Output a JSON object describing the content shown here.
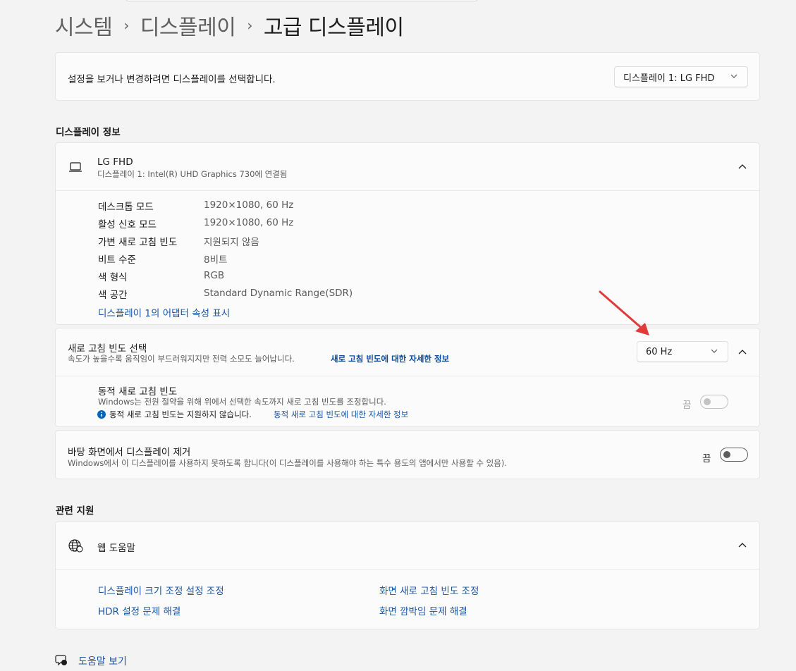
{
  "breadcrumb": {
    "items": [
      "시스템",
      "디스플레이",
      "고급 디스플레이"
    ],
    "separator": "›"
  },
  "select_display": {
    "prompt": "설정을 보거나 변경하려면 디스플레이를 선택합니다.",
    "selected": "디스플레이 1: LG FHD"
  },
  "display_info": {
    "section_title": "디스플레이 정보",
    "monitor_name": "LG FHD",
    "monitor_sub": "디스플레이 1: Intel(R) UHD Graphics 730에 연결됨",
    "rows": [
      {
        "label": "데스크톱 모드",
        "value": "1920×1080, 60 Hz"
      },
      {
        "label": "활성 신호 모드",
        "value": "1920×1080, 60 Hz"
      },
      {
        "label": "가변 새로 고침 빈도",
        "value": "지원되지 않음"
      },
      {
        "label": "비트 수준",
        "value": "8비트"
      },
      {
        "label": "색 형식",
        "value": "RGB"
      },
      {
        "label": "색 공간",
        "value": "Standard Dynamic Range(SDR)"
      }
    ],
    "adapter_link": "디스플레이 1의 어댑터 속성 표시"
  },
  "refresh_rate": {
    "title": "새로 고침 빈도 선택",
    "description": "속도가 높을수록 움직임이 부드러워지지만 전력 소모도 늘어납니다.",
    "more_link": "새로 고침 빈도에 대한 자세한 정보",
    "selected": "60 Hz",
    "dynamic": {
      "title": "동적 새로 고침 빈도",
      "description": "Windows는 전원 절약을 위해 위에서 선택한 속도까지 새로 고침 빈도를 조정합니다.",
      "note": "동적 새로 고침 빈도는 지원하지 않습니다.",
      "note_link": "동적 새로 고침 빈도에 대한 자세한 정보",
      "state_label": "끔",
      "enabled": false
    }
  },
  "remove_display": {
    "title": "바탕 화면에서 디스플레이 제거",
    "description": "Windows에서 이 디스플레이를 사용하지 못하도록 합니다(이 디스플레이를 사용해야 하는 특수 용도의 앱에서만 사용할 수 있음).",
    "state_label": "끔",
    "enabled": false
  },
  "related": {
    "section_title": "관련 지원",
    "web_help": "웹 도움말",
    "links": [
      "디스플레이 크기 조정 설정 조정",
      "화면 새로 고침 빈도 조정",
      "HDR 설정 문제 해결",
      "화면 깜박임 문제 해결"
    ]
  },
  "get_help": "도움말 보기",
  "colors": {
    "accent_link": "#1a56a6",
    "annotation_arrow": "#e03a3a",
    "info_icon": "#0067c0"
  }
}
